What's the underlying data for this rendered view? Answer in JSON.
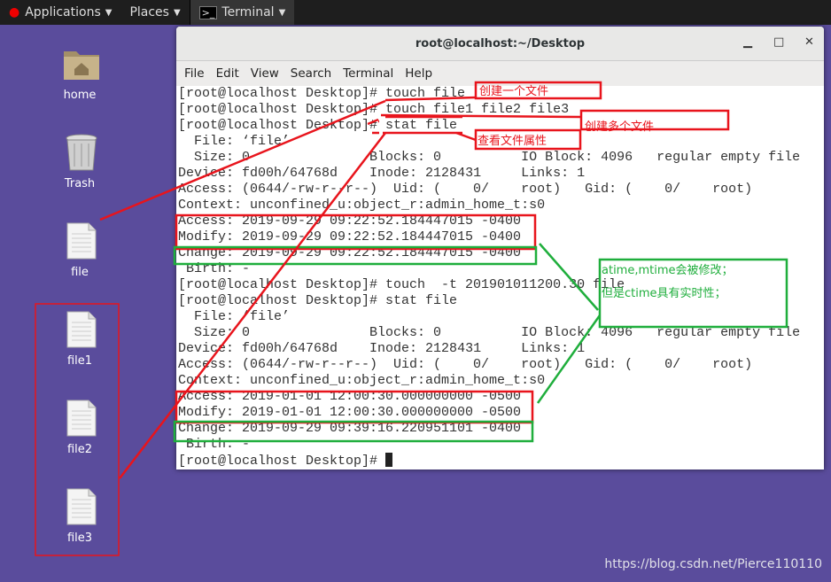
{
  "topbar": {
    "applications": "Applications",
    "places": "Places",
    "terminal": "Terminal"
  },
  "desktop": {
    "icons": [
      {
        "label": "home",
        "icon": "home-folder-icon"
      },
      {
        "label": "Trash",
        "icon": "trash-icon"
      },
      {
        "label": "file",
        "icon": "file-icon"
      },
      {
        "label": "file1",
        "icon": "file-icon"
      },
      {
        "label": "file2",
        "icon": "file-icon"
      },
      {
        "label": "file3",
        "icon": "file-icon"
      }
    ]
  },
  "window": {
    "title": "root@localhost:~/Desktop",
    "menu": [
      "File",
      "Edit",
      "View",
      "Search",
      "Terminal",
      "Help"
    ]
  },
  "terminal": {
    "lines": [
      "[root@localhost Desktop]# touch file",
      "[root@localhost Desktop]# touch file1 file2 file3",
      "[root@localhost Desktop]# stat file",
      "  File: ‘file’",
      "  Size: 0         \tBlocks: 0          IO Block: 4096   regular empty file",
      "Device: fd00h/64768d\tInode: 2128431     Links: 1",
      "Access: (0644/-rw-r--r--)  Uid: (    0/    root)   Gid: (    0/    root)",
      "Context: unconfined_u:object_r:admin_home_t:s0",
      "Access: 2019-09-29 09:22:52.184447015 -0400",
      "Modify: 2019-09-29 09:22:52.184447015 -0400",
      "Change: 2019-09-29 09:22:52.184447015 -0400",
      " Birth: -",
      "[root@localhost Desktop]# touch  -t 201901011200.30 file",
      "[root@localhost Desktop]# stat file",
      "  File: ‘file’",
      "  Size: 0         \tBlocks: 0          IO Block: 4096   regular empty file",
      "Device: fd00h/64768d\tInode: 2128431     Links: 1",
      "Access: (0644/-rw-r--r--)  Uid: (    0/    root)   Gid: (    0/    root)",
      "Context: unconfined_u:object_r:admin_home_t:s0",
      "Access: 2019-01-01 12:00:30.000000000 -0500",
      "Modify: 2019-01-01 12:00:30.000000000 -0500",
      "Change: 2019-09-29 09:39:16.220951101 -0400",
      " Birth: -"
    ],
    "prompt": "[root@localhost Desktop]# "
  },
  "annotations": {
    "create_one": "创建一个文件",
    "create_many": "创建多个文件",
    "view_attrs": "查看文件属性",
    "note1": "atime,mtime会被修改；",
    "note2": "但是ctime具有实时性；",
    "red": "#e8141c",
    "green": "#1fae3c"
  },
  "watermark": "https://blog.csdn.net/Pierce110110"
}
